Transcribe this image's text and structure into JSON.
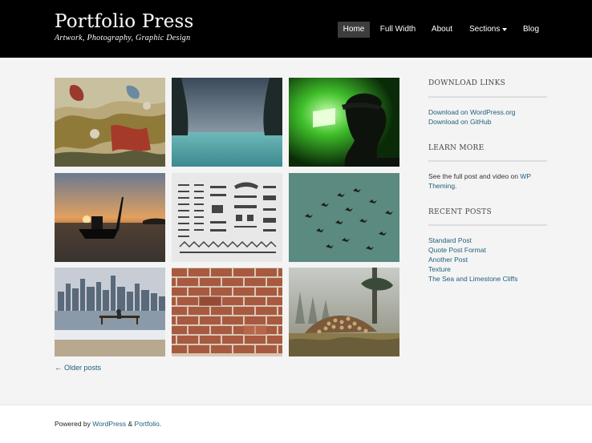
{
  "site": {
    "title": "Portfolio Press",
    "tagline": "Artwork, Photography, Graphic Design"
  },
  "nav": {
    "items": [
      {
        "label": "Home",
        "active": true
      },
      {
        "label": "Full Width"
      },
      {
        "label": "About"
      },
      {
        "label": "Sections",
        "has_dropdown": true
      },
      {
        "label": "Blog"
      }
    ]
  },
  "posts": [
    {
      "subject": "peeling painted wall texture",
      "icon": "image-icon"
    },
    {
      "subject": "sea and limestone cliffs",
      "icon": "image-icon"
    },
    {
      "subject": "person in cap against green light",
      "icon": "image-icon"
    },
    {
      "subject": "boat at sunset",
      "icon": "image-icon"
    },
    {
      "subject": "typographic ornaments sheet",
      "icon": "image-icon"
    },
    {
      "subject": "birds flying in teal sky",
      "icon": "image-icon"
    },
    {
      "subject": "city skyline by the water",
      "icon": "image-icon"
    },
    {
      "subject": "red brick wall",
      "icon": "image-icon"
    },
    {
      "subject": "pile of logs in misty forest",
      "icon": "image-icon"
    }
  ],
  "pagination": {
    "older_label": "Older posts",
    "arrow": "←"
  },
  "sidebar": {
    "download": {
      "title": "DOWNLOAD LINKS",
      "links": [
        "Download on WordPress.org",
        "Download on GitHub"
      ]
    },
    "learn": {
      "title": "LEARN MORE",
      "text_before": "See the full post and video on ",
      "link1": "WP",
      "link2": "Theming",
      "text_after": "."
    },
    "recent": {
      "title": "RECENT POSTS",
      "links": [
        "Standard Post",
        "Quote Post Format",
        "Another Post",
        "Texture",
        "The Sea and Limestone Cliffs"
      ]
    }
  },
  "footer": {
    "powered": "Powered by ",
    "wordpress": "WordPress",
    "amp": " & ",
    "portfolio": "Portfolio",
    "end": "."
  },
  "colors": {
    "header_bg": "#000000",
    "link": "#1e5f7a",
    "body_bg": "#f4f4f4",
    "nav_active_bg": "#3d3d3d"
  }
}
